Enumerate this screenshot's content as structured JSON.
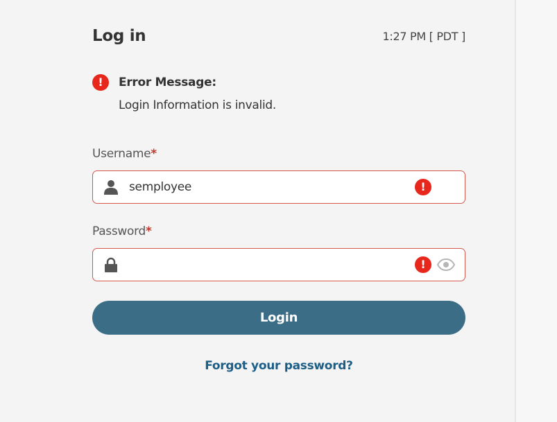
{
  "header": {
    "title": "Log in",
    "time": "1:27 PM [ PDT ]"
  },
  "error": {
    "icon": "error-icon",
    "title": "Error Message:",
    "message": "Login Information is invalid."
  },
  "username": {
    "label": "Username",
    "required_mark": "*",
    "value": "semployee",
    "lead_icon": "user-icon",
    "status_icon": "error-icon"
  },
  "password": {
    "label": "Password",
    "required_mark": "*",
    "value": "",
    "lead_icon": "lock-icon",
    "status_icon": "error-icon",
    "toggle_icon": "eye-icon"
  },
  "actions": {
    "login_label": "Login",
    "forgot_label": "Forgot your password?"
  },
  "colors": {
    "background": "#f4f4f4",
    "error": "#e8271c",
    "field_border_error": "#d2574c",
    "primary_button": "#3b6e86",
    "link": "#1d5e87"
  }
}
